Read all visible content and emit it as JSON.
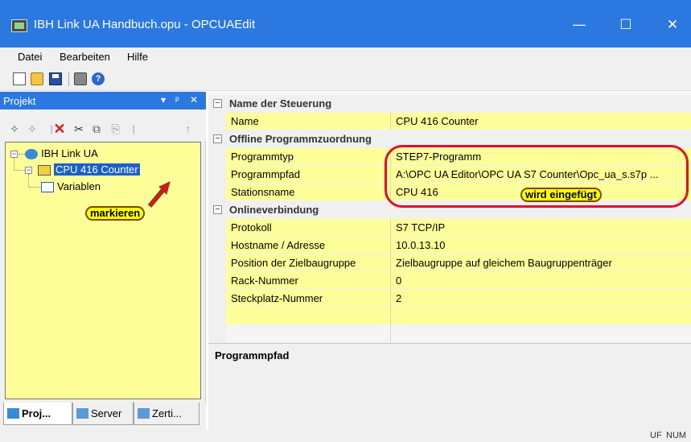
{
  "window": {
    "title": "IBH Link UA Handbuch.opu - OPCUAEdit",
    "controls": {
      "minimize": "—",
      "maximize": "☐",
      "close": "✕"
    }
  },
  "menu": {
    "items": [
      "Datei",
      "Bearbeiten",
      "Hilfe"
    ]
  },
  "toolbar": {
    "icons": [
      "new-file-icon",
      "open-folder-icon",
      "save-icon",
      "print-icon",
      "help-icon"
    ]
  },
  "left_panel": {
    "title": "Projekt",
    "header_buttons": {
      "dropdown": "▾",
      "pin": "ᵖ",
      "close": "✕"
    },
    "tree": {
      "root": {
        "label": "IBH Link UA",
        "expander": "−"
      },
      "plc": {
        "label": "CPU 416 Counter",
        "expander": "−"
      },
      "variables": {
        "label": "Variablen"
      }
    },
    "tabs": [
      {
        "label": "Proj..."
      },
      {
        "label": "Server"
      },
      {
        "label": "Zerti..."
      }
    ]
  },
  "property_grid": {
    "categories": [
      {
        "label": "Name der Steuerung",
        "expander": "−",
        "rows": [
          {
            "name": "Name",
            "value": "CPU 416 Counter"
          }
        ]
      },
      {
        "label": "Offline Programmzuordnung",
        "expander": "−",
        "rows": [
          {
            "name": "Programmtyp",
            "value": "STEP7-Programm"
          },
          {
            "name": "Programmpfad",
            "value": "A:\\OPC UA Editor\\OPC UA S7 Counter\\Opc_ua_s.s7p ..."
          },
          {
            "name": "Stationsname",
            "value": "CPU 416"
          }
        ]
      },
      {
        "label": "Onlineverbindung",
        "expander": "−",
        "rows": [
          {
            "name": "Protokoll",
            "value": "S7 TCP/IP"
          },
          {
            "name": "Hostname / Adresse",
            "value": "10.0.13.10"
          },
          {
            "name": "Position der Zielbaugruppe",
            "value": "Zielbaugruppe auf gleichem Baugruppenträger"
          },
          {
            "name": "Rack-Nummer",
            "value": "0"
          },
          {
            "name": "Steckplatz-Nummer",
            "value": "2"
          }
        ]
      }
    ]
  },
  "description_pane": {
    "title": "Programmpfad"
  },
  "annotations": {
    "inserted_callout": "wird eingefügt",
    "mark_callout": "markieren"
  },
  "statusbar": {
    "caps": "UF",
    "num": "NUM"
  },
  "colors": {
    "accent": "#2b78e0",
    "highlight_yellow": "#ffff99",
    "annotation_red": "#e0102a",
    "selection": "#1b5fcc"
  }
}
